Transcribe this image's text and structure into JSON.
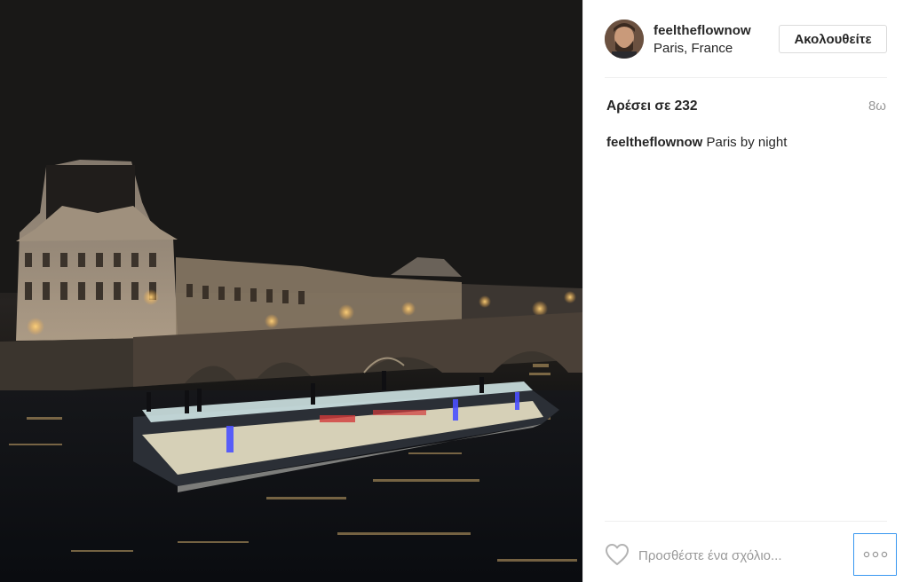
{
  "post": {
    "photo_icon": "night-paris-photo",
    "username": "feeltheflownow",
    "location": "Paris, France",
    "follow_label": "Ακολουθείτε",
    "likes": "Αρέσει σε 232",
    "time": "8ω",
    "caption_user": "feeltheflownow",
    "caption_text": " Paris by night",
    "comment_placeholder": "Προσθέστε ένα σχόλιο...",
    "like_icon": "heart-icon",
    "more_icon": "ellipsis-icon",
    "accent": "#3897f0"
  }
}
